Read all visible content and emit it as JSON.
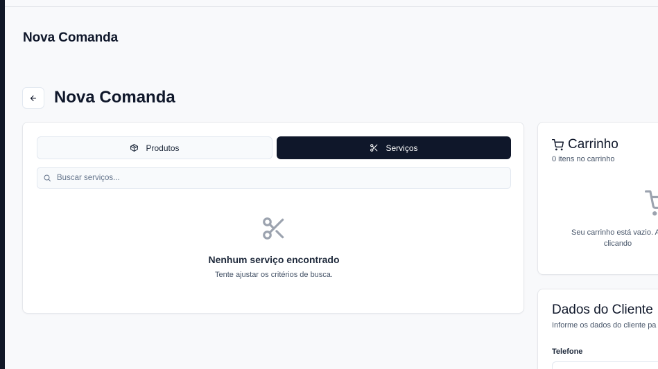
{
  "header": {
    "title": "Nova Comanda"
  },
  "page": {
    "title": "Nova Comanda"
  },
  "tabs": [
    {
      "label": "Produtos",
      "icon": "package-icon",
      "active": false
    },
    {
      "label": "Serviços",
      "icon": "scissors-icon",
      "active": true
    }
  ],
  "search": {
    "placeholder": "Buscar serviços...",
    "value": ""
  },
  "empty_state": {
    "icon": "scissors-icon",
    "title": "Nenhum serviço encontrado",
    "subtitle": "Tente ajustar os critérios de busca."
  },
  "cart": {
    "title": "Carrinho",
    "count_text": "0 itens no carrinho",
    "empty_line1": "Seu carrinho está vazio. Ad",
    "empty_line2": "clicando"
  },
  "client": {
    "title": "Dados do Cliente",
    "subtitle": "Informe os dados do cliente pa",
    "phone_label": "Telefone"
  },
  "colors": {
    "primary": "#0f172a",
    "background": "#f8f9fb",
    "border": "#e2e8f0",
    "muted_text": "#475569",
    "empty_icon": "#9ca3af"
  }
}
